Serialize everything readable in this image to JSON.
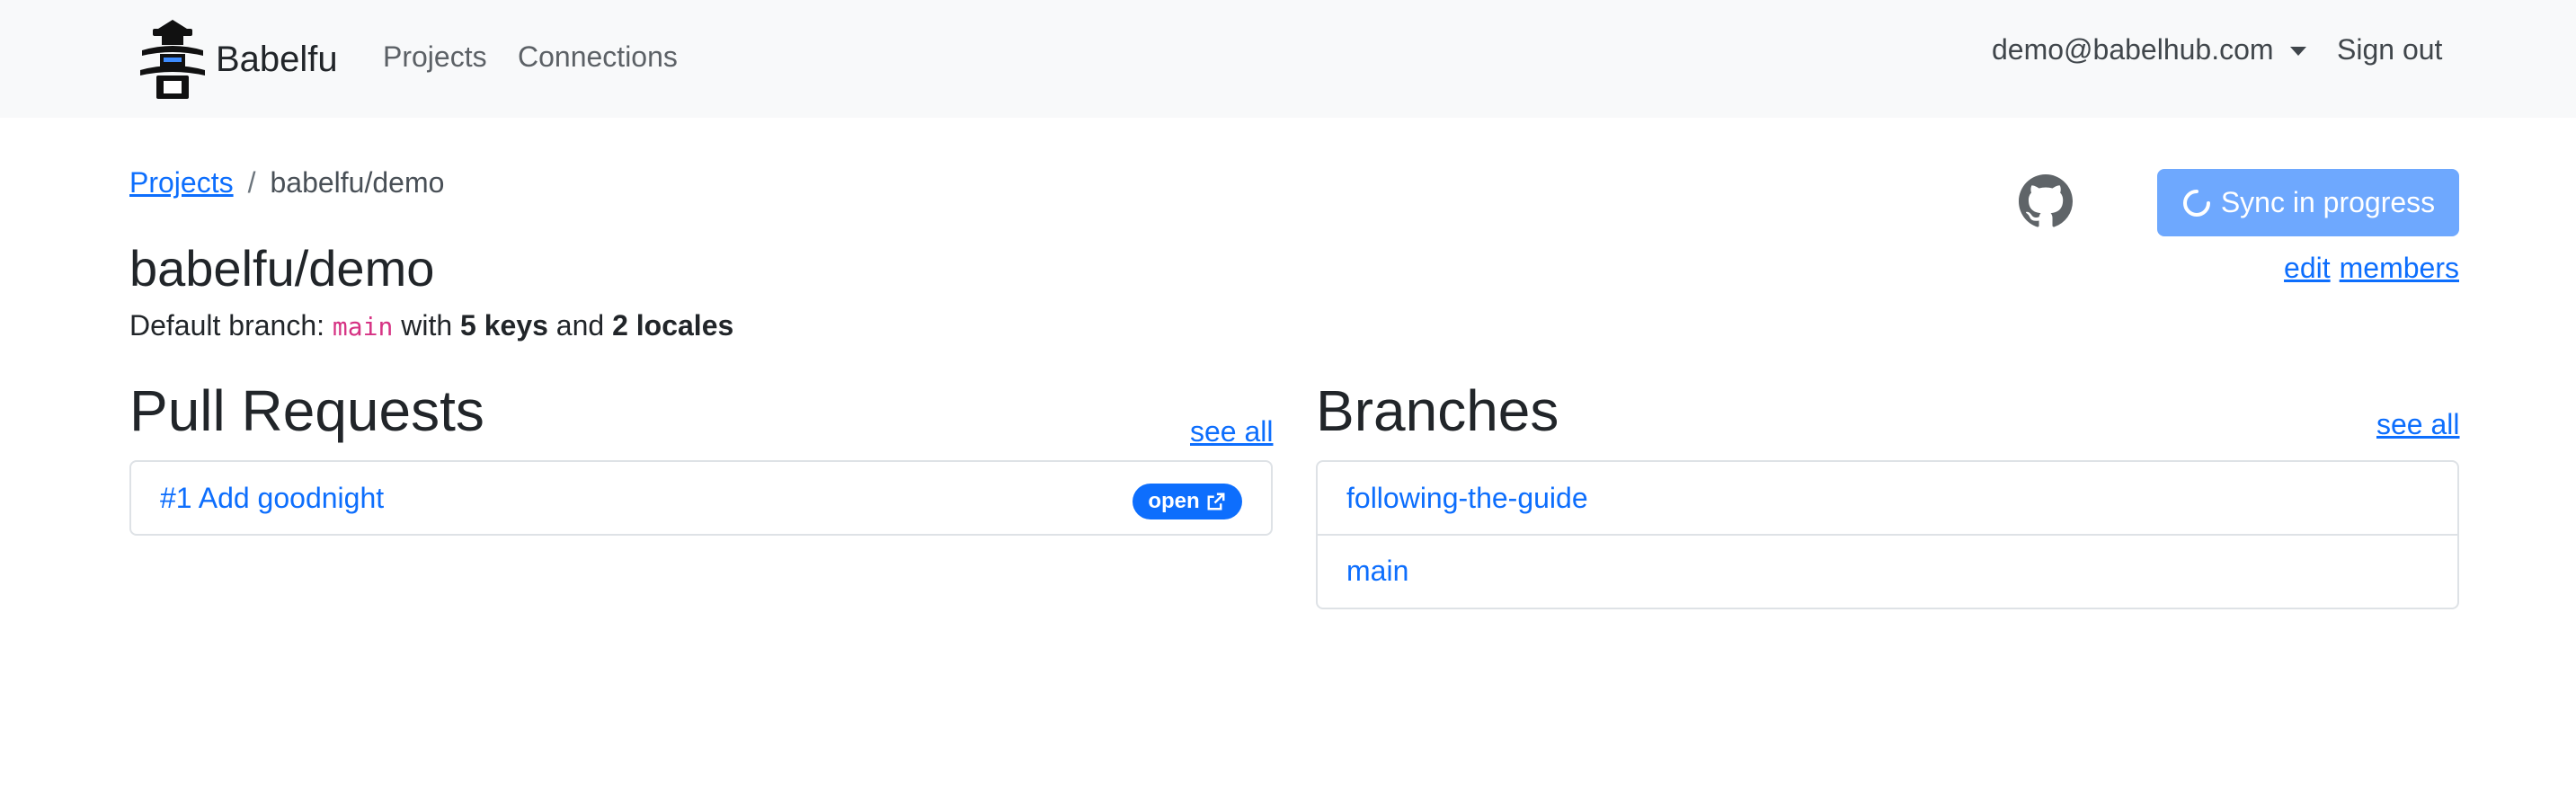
{
  "navbar": {
    "brand": "Babelfu",
    "links": [
      {
        "label": "Projects"
      },
      {
        "label": "Connections"
      }
    ],
    "user_email": "demo@babelhub.com",
    "sign_out": "Sign out"
  },
  "breadcrumb": {
    "parent": "Projects",
    "separator": "/",
    "current": "babelfu/demo"
  },
  "project": {
    "title": "babelfu/demo",
    "summary_prefix": "Default branch:",
    "default_branch": "main",
    "summary_with": "with",
    "keys": "5 keys",
    "summary_and": "and",
    "locales": "2 locales"
  },
  "actions": {
    "github_icon": "github-icon",
    "sync_label": "Sync in progress",
    "sync_icon": "spinner-icon",
    "edit": "edit",
    "members": "members"
  },
  "pull_requests": {
    "title": "Pull Requests",
    "see_all": "see all",
    "items": [
      {
        "label": "#1 Add goodnight",
        "status": "open",
        "status_icon": "external-link-icon"
      }
    ]
  },
  "branches": {
    "title": "Branches",
    "see_all": "see all",
    "items": [
      {
        "label": "following-the-guide"
      },
      {
        "label": "main"
      }
    ]
  },
  "colors": {
    "primary": "#0d6efd",
    "sync_button": "#6ea8fe",
    "navbar_bg": "#f8f9fa",
    "code": "#d63384"
  }
}
